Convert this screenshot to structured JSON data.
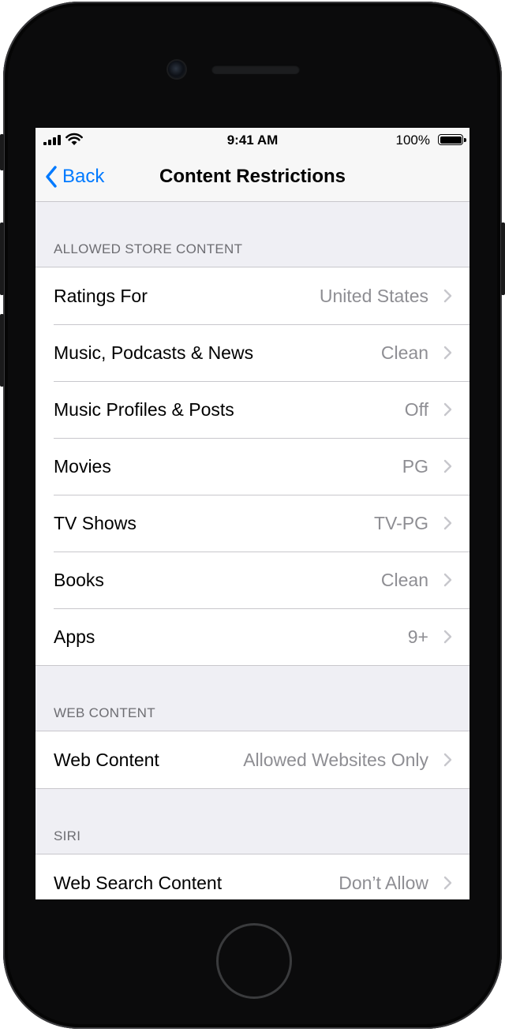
{
  "status_bar": {
    "time": "9:41 AM",
    "battery": "100%"
  },
  "nav": {
    "back_label": "Back",
    "title": "Content Restrictions"
  },
  "sections": [
    {
      "header": "ALLOWED STORE CONTENT",
      "rows": [
        {
          "label": "Ratings For",
          "value": "United States"
        },
        {
          "label": "Music, Podcasts & News",
          "value": "Clean"
        },
        {
          "label": "Music Profiles & Posts",
          "value": "Off"
        },
        {
          "label": "Movies",
          "value": "PG"
        },
        {
          "label": "TV Shows",
          "value": "TV-PG"
        },
        {
          "label": "Books",
          "value": "Clean"
        },
        {
          "label": "Apps",
          "value": "9+"
        }
      ]
    },
    {
      "header": "WEB CONTENT",
      "rows": [
        {
          "label": "Web Content",
          "value": "Allowed Websites Only"
        }
      ]
    },
    {
      "header": "SIRI",
      "rows": [
        {
          "label": "Web Search Content",
          "value": "Don’t Allow"
        }
      ]
    }
  ],
  "icons": {
    "back": "chevron-left-icon",
    "row_disclosure": "chevron-right-icon",
    "signal": "cellular-signal-icon",
    "wifi": "wifi-icon",
    "battery": "battery-icon"
  },
  "colors": {
    "accent": "#007aff",
    "background": "#efeff4",
    "secondary_text": "#8e8e93",
    "header_text": "#6d6d72"
  }
}
